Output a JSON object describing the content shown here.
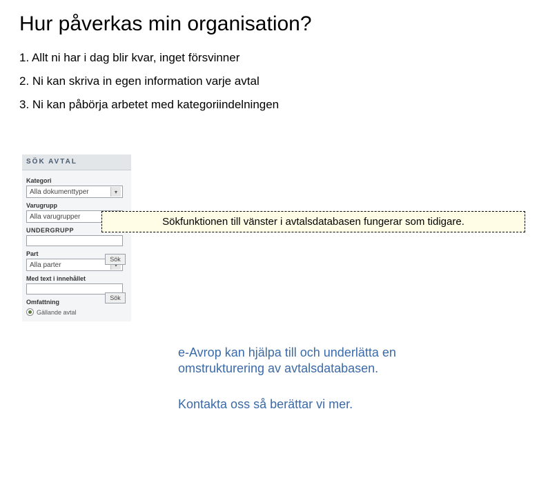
{
  "title": "Hur påverkas min organisation?",
  "list": {
    "i1": "1. Allt ni har i dag blir kvar, inget försvinner",
    "i2": "2. Ni kan skriva in egen information varje avtal",
    "i3": "3. Ni kan påbörja arbetet med kategoriindelningen"
  },
  "panel": {
    "header": "SÖK AVTAL",
    "kategori_lbl": "Kategori",
    "kategori_val": "Alla dokumenttyper",
    "varugrupp_lbl": "Varugrupp",
    "varugrupp_val": "Alla varugrupper",
    "undergrupp_lbl": "UNDERGRUPP",
    "part_lbl": "Part",
    "part_val": "Alla parter",
    "medtext_lbl": "Med text i innehållet",
    "omfattning_lbl": "Omfattning",
    "radio_lbl": "Gällande avtal"
  },
  "buttons": {
    "sok": "Sök"
  },
  "hint": "Sökfunktionen till vänster i avtalsdatabasen fungerar som tidigare.",
  "footer": {
    "p1": "e-Avrop kan hjälpa till och underlätta en omstrukturering av avtalsdatabasen.",
    "p2": "Kontakta oss så berättar vi mer."
  }
}
